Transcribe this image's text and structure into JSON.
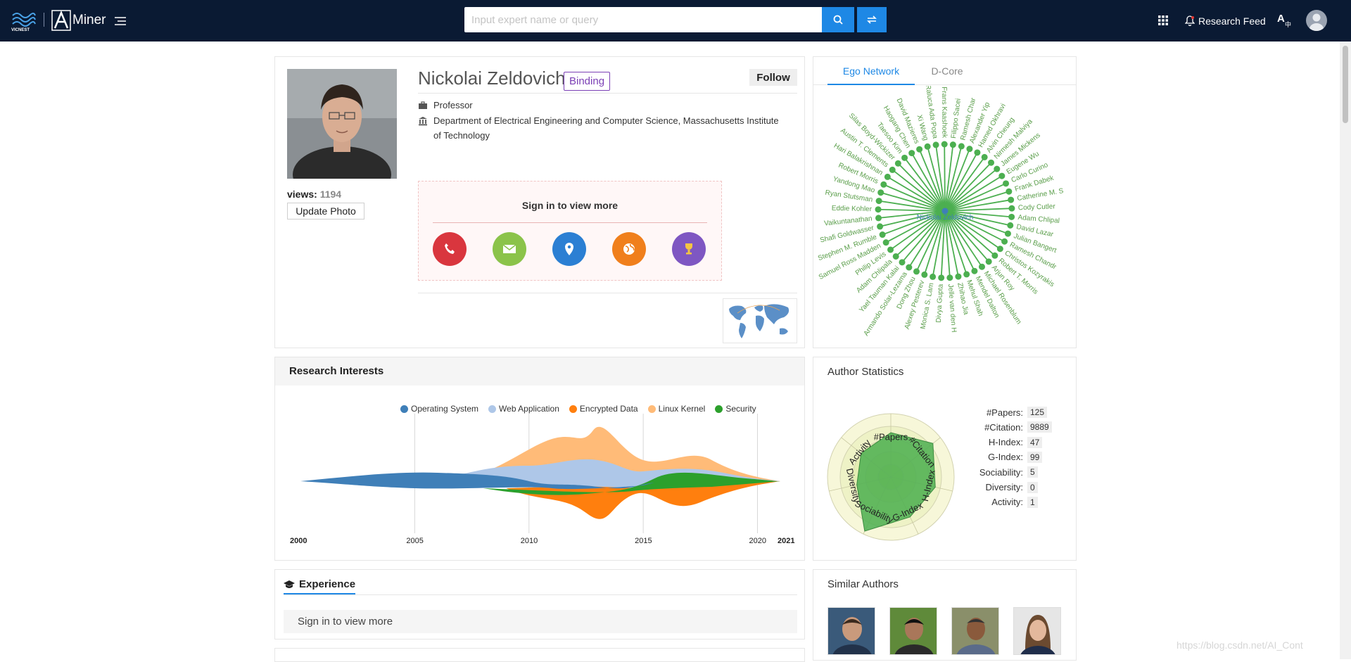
{
  "header": {
    "brand_left": "VICNEST",
    "brand_right": "Miner",
    "search_placeholder": "Input expert name or query",
    "research_feed": "Research Feed",
    "bg_color": "#0a1a33",
    "accent": "#1e88e5"
  },
  "profile": {
    "name": "Nickolai Zeldovich",
    "binding": "Binding",
    "follow": "Follow",
    "position": "Professor",
    "affiliation": "Department of Electrical Engineering and Computer Science, Massachusetts Institute of Technology",
    "views_label": "views:",
    "views_value": "1194",
    "update_photo": "Update Photo",
    "signin_more": "Sign in to view more",
    "contact_icons": [
      {
        "name": "phone-icon",
        "color": "#d9363e"
      },
      {
        "name": "email-icon",
        "color": "#8bc34a"
      },
      {
        "name": "location-icon",
        "color": "#2b7fd3"
      },
      {
        "name": "homepage-icon",
        "color": "#f07f1c"
      },
      {
        "name": "award-icon",
        "color": "#7e57c2"
      }
    ]
  },
  "ego": {
    "tabs": [
      "Ego Network",
      "D-Core"
    ],
    "center": "Nickolai Zeldovich",
    "nodes": [
      "Filippo Sacei",
      "Ramesh Char",
      "Alexander Yip",
      "Hamed Okhravi",
      "Alvin Cheung",
      "Nirmesh Malviya",
      "James Mickens",
      "Eugene Wu",
      "Carlo Curino",
      "Frank Dabek",
      "Catherine M. S",
      "Cody Cutler",
      "Adam Chlipal",
      "David Lazar",
      "Julian Bangert",
      "Ramesh Chandr",
      "Christos Kozyrakis",
      "Robert T. Morris",
      "Arjun Roy",
      "Michael Rosenblum",
      "Mendel Dalton",
      "Mehul Shah",
      "Zhihao Jia",
      "Jelle van den H",
      "Divya Gupta",
      "Monica S. Lam",
      "Alexey Pesterev",
      "Dong Zhou",
      "Armando Solar-Lezama",
      "Yael Tauman Kalai",
      "Adam Chlipala",
      "Philip Levis",
      "Samuel Ross Madden",
      "Stephen M. Rumble",
      "Shafi Goldwasser",
      "Vaikuntanathan",
      "Eddie Kohler",
      "Ryan Stutsman",
      "Yandong Mao",
      "Robert Morris",
      "Hari Balakrishnan",
      "Austin T. Clements",
      "Silas Boyd-Wickizer",
      "Taesoo Kim",
      "Haogang Chen",
      "David Mazieres",
      "Xi Wang",
      "Raluca Ada Popa",
      "M. Frans Kaashoek"
    ]
  },
  "research": {
    "title": "Research Interests",
    "legend": [
      {
        "name": "Operating System",
        "color": "#3f7fb8"
      },
      {
        "name": "Web Application",
        "color": "#aec7e8"
      },
      {
        "name": "Encrypted Data",
        "color": "#ff7f0e"
      },
      {
        "name": "Linux Kernel",
        "color": "#ffbb78"
      },
      {
        "name": "Security",
        "color": "#2ca02c"
      }
    ],
    "x_ticks": [
      "2000",
      "2005",
      "2010",
      "2015",
      "2020",
      "2021"
    ]
  },
  "chart_data": {
    "type": "area",
    "title": "Research Interests",
    "x": [
      2000,
      2005,
      2010,
      2015,
      2020,
      2021
    ],
    "xlim": [
      2000,
      2021
    ],
    "series": [
      {
        "name": "Operating System",
        "values": [
          0.1,
          0.5,
          0.6,
          0.2,
          0.05,
          0.0
        ]
      },
      {
        "name": "Web Application",
        "values": [
          0.0,
          0.1,
          0.5,
          0.5,
          0.2,
          0.0
        ]
      },
      {
        "name": "Encrypted Data",
        "values": [
          0.0,
          0.0,
          0.6,
          0.8,
          0.3,
          0.0
        ]
      },
      {
        "name": "Linux Kernel",
        "values": [
          0.0,
          0.0,
          0.7,
          0.5,
          0.3,
          0.0
        ]
      },
      {
        "name": "Security",
        "values": [
          0.0,
          0.05,
          0.2,
          0.3,
          0.3,
          0.0
        ]
      }
    ]
  },
  "stats": {
    "title": "Author Statistics",
    "radar_axes": [
      "#Papers",
      "#Citation",
      "H-Index",
      "G-Index",
      "Sociability",
      "Diversity",
      "Activity"
    ],
    "rows": [
      {
        "label": "#Papers:",
        "value": "125"
      },
      {
        "label": "#Citation:",
        "value": "9889"
      },
      {
        "label": "H-Index:",
        "value": "47"
      },
      {
        "label": "G-Index:",
        "value": "99"
      },
      {
        "label": "Sociability:",
        "value": "5"
      },
      {
        "label": "Diversity:",
        "value": "0"
      },
      {
        "label": "Activity:",
        "value": "1"
      }
    ],
    "radar_values": [
      0.7,
      0.85,
      0.72,
      0.7,
      0.95,
      0.55,
      0.6
    ]
  },
  "experience": {
    "title": "Experience",
    "signin": "Sign in to view more"
  },
  "similar": {
    "title": "Similar Authors"
  },
  "watermark": "https://blog.csdn.net/AI_Cont"
}
